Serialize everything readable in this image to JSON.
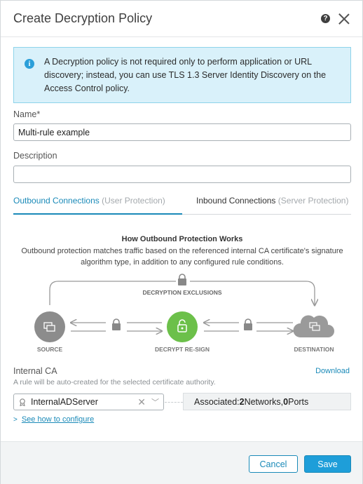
{
  "dialog": {
    "title": "Create Decryption Policy",
    "help_icon": "?"
  },
  "info": {
    "icon": "i",
    "text": "A Decryption policy is not required only to perform application or URL discovery; instead, you can use TLS 1.3 Server Identity Discovery on the Access Control policy."
  },
  "name_field": {
    "label": "Name*",
    "value": "Multi-rule example"
  },
  "description_field": {
    "label": "Description",
    "value": ""
  },
  "tabs": [
    {
      "label": "Outbound Connections",
      "sub": "(User Protection)",
      "active": true
    },
    {
      "label": "Inbound Connections",
      "sub": "(Server Protection)",
      "active": false
    }
  ],
  "diagram": {
    "title": "How Outbound Protection Works",
    "description": "Outbound protection matches traffic based on the referenced internal CA certificate's signature algorithm type, in addition to any configured rule conditions.",
    "exclusions_label": "DECRYPTION EXCLUSIONS",
    "source_label": "SOURCE",
    "decrypt_label": "DECRYPT RE-SIGN",
    "destination_label": "DESTINATION",
    "colors": {
      "node_gray": "#8c8c8c",
      "node_green": "#6cc04a",
      "arrow": "#999999",
      "cloud": "#9a9a9a"
    }
  },
  "internal_ca": {
    "label": "Internal CA",
    "download_label": "Download",
    "hint": "A rule will be auto-created for the selected certificate authority.",
    "selected": "InternalADServer",
    "associated_prefix": "Associated: ",
    "networks_count": "2",
    "networks_label": " Networks, ",
    "ports_count": "0",
    "ports_label": " Ports"
  },
  "howto_label": "See how to configure",
  "footer": {
    "cancel_label": "Cancel",
    "save_label": "Save"
  },
  "colors": {
    "accent": "#1a8ab8",
    "primary_button": "#1e9ed9",
    "info_bg": "#d9f1fa",
    "info_border": "#8ed3ea"
  }
}
